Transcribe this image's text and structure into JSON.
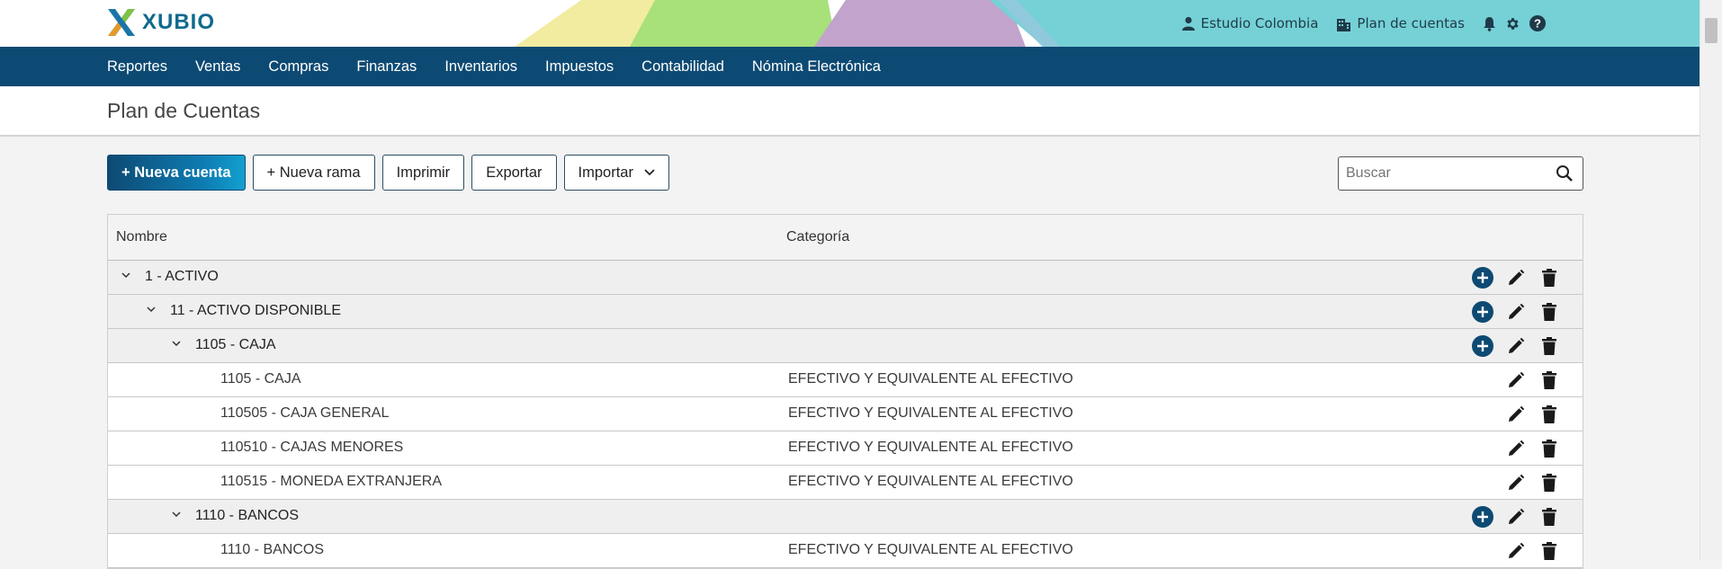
{
  "brand": {
    "name": "XUBIO"
  },
  "header_right": {
    "user_label": "Estudio Colombia",
    "plan_label": "Plan de cuentas"
  },
  "nav": {
    "items": [
      "Reportes",
      "Ventas",
      "Compras",
      "Finanzas",
      "Inventarios",
      "Impuestos",
      "Contabilidad",
      "Nómina Electrónica"
    ]
  },
  "page": {
    "title": "Plan de Cuentas"
  },
  "toolbar": {
    "new_account": "+ Nueva cuenta",
    "new_branch": "+ Nueva rama",
    "print": "Imprimir",
    "export": "Exportar",
    "import": "Importar"
  },
  "search": {
    "placeholder": "Buscar",
    "value": ""
  },
  "table": {
    "headers": {
      "name": "Nombre",
      "category": "Categoría"
    },
    "rows": [
      {
        "type": "group",
        "level": 0,
        "label": "1 - ACTIVO",
        "category": "",
        "expanded": true
      },
      {
        "type": "group",
        "level": 1,
        "label": "11 - ACTIVO DISPONIBLE",
        "category": "",
        "expanded": true
      },
      {
        "type": "group",
        "level": 2,
        "label": "1105 - CAJA",
        "category": "",
        "expanded": true
      },
      {
        "type": "leaf",
        "level": 3,
        "label": "1105 - CAJA",
        "category": "EFECTIVO Y EQUIVALENTE AL EFECTIVO"
      },
      {
        "type": "leaf",
        "level": 3,
        "label": "110505 - CAJA GENERAL",
        "category": "EFECTIVO Y EQUIVALENTE AL EFECTIVO"
      },
      {
        "type": "leaf",
        "level": 3,
        "label": "110510 - CAJAS MENORES",
        "category": "EFECTIVO Y EQUIVALENTE AL EFECTIVO"
      },
      {
        "type": "leaf",
        "level": 3,
        "label": "110515 - MONEDA EXTRANJERA",
        "category": "EFECTIVO Y EQUIVALENTE AL EFECTIVO"
      },
      {
        "type": "group",
        "level": 2,
        "label": "1110 - BANCOS",
        "category": "",
        "expanded": true
      },
      {
        "type": "leaf",
        "level": 3,
        "label": "1110 - BANCOS",
        "category": "EFECTIVO Y EQUIVALENTE AL EFECTIVO"
      }
    ]
  },
  "icons": {
    "user": "user-icon",
    "building": "building-icon",
    "bell": "bell-icon",
    "gear": "gear-icon",
    "help": "help-icon",
    "search": "search-icon",
    "add": "add-circle-icon",
    "edit": "pencil-icon",
    "delete": "trash-icon",
    "caret": "chevron-down-icon"
  },
  "colors": {
    "nav_bg": "#0d4a73",
    "primary_button": "#0e7cb2",
    "accent_add": "#0d4a73"
  }
}
